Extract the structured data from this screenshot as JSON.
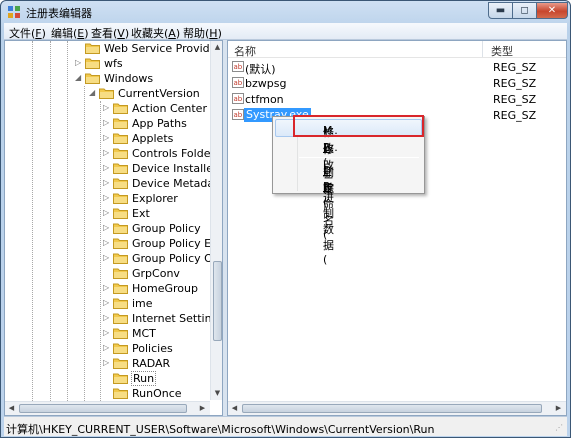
{
  "window": {
    "title": "注册表编辑器",
    "controls": {
      "minimize": "▬",
      "maximize": "◻",
      "close": "✕"
    }
  },
  "menu": [
    {
      "label": "文件(",
      "key": "F",
      "end": ")"
    },
    {
      "label": "编辑(",
      "key": "E",
      "end": ")"
    },
    {
      "label": "查看(",
      "key": "V",
      "end": ")"
    },
    {
      "label": "收藏夹(",
      "key": "A",
      "end": ")"
    },
    {
      "label": "帮助(",
      "key": "H",
      "end": ")"
    }
  ],
  "tree": [
    {
      "label": "Web Service Providers",
      "arrow": "",
      "selected": false
    },
    {
      "label": "wfs",
      "arrow": "▷",
      "selected": false
    },
    {
      "label": "Windows",
      "arrow": "◢",
      "selected": false
    },
    {
      "label": "CurrentVersion",
      "arrow": "◢",
      "selected": false
    },
    {
      "label": "Action Center",
      "arrow": "▷",
      "selected": false
    },
    {
      "label": "App Paths",
      "arrow": "▷",
      "selected": false
    },
    {
      "label": "Applets",
      "arrow": "▷",
      "selected": false
    },
    {
      "label": "Controls Folder",
      "arrow": "▷",
      "selected": false
    },
    {
      "label": "Device Installer",
      "arrow": "▷",
      "selected": false
    },
    {
      "label": "Device Metadata",
      "arrow": "▷",
      "selected": false
    },
    {
      "label": "Explorer",
      "arrow": "▷",
      "selected": false
    },
    {
      "label": "Ext",
      "arrow": "▷",
      "selected": false
    },
    {
      "label": "Group Policy",
      "arrow": "▷",
      "selected": false
    },
    {
      "label": "Group Policy Editor",
      "arrow": "▷",
      "selected": false
    },
    {
      "label": "Group Policy Objects",
      "arrow": "▷",
      "selected": false
    },
    {
      "label": "GrpConv",
      "arrow": "",
      "selected": false
    },
    {
      "label": "HomeGroup",
      "arrow": "▷",
      "selected": false
    },
    {
      "label": "ime",
      "arrow": "▷",
      "selected": false
    },
    {
      "label": "Internet Settings",
      "arrow": "▷",
      "selected": false
    },
    {
      "label": "MCT",
      "arrow": "▷",
      "selected": false
    },
    {
      "label": "Policies",
      "arrow": "▷",
      "selected": false
    },
    {
      "label": "RADAR",
      "arrow": "▷",
      "selected": false
    },
    {
      "label": "Run",
      "arrow": "",
      "selected": true
    },
    {
      "label": "RunOnce",
      "arrow": "",
      "selected": false
    }
  ],
  "values_pane": {
    "columns": {
      "name": "名称",
      "type": "类型"
    },
    "rows": [
      {
        "name": "(默认)",
        "type": "REG_SZ",
        "selected": false
      },
      {
        "name": "bzwpsg",
        "type": "REG_SZ",
        "selected": false
      },
      {
        "name": "ctfmon",
        "type": "REG_SZ",
        "selected": false
      },
      {
        "name": "Systray.exe",
        "type": "REG_SZ",
        "selected": true
      }
    ],
    "value_icon": "ab-string-icon"
  },
  "context_menu": [
    {
      "label": "修改(",
      "key": "M",
      "end": ")...",
      "highlighted": true
    },
    {
      "label": "修改二进制数据(",
      "key": "B",
      "end": ")...",
      "highlighted": false
    },
    {
      "label": "删除(",
      "key": "D",
      "end": ")",
      "highlighted": false
    },
    {
      "label": "重命名(",
      "key": "R",
      "end": ")",
      "highlighted": false
    }
  ],
  "status": {
    "path": "计算机\\HKEY_CURRENT_USER\\Software\\Microsoft\\Windows\\CurrentVersion\\Run"
  },
  "colors": {
    "accent_selection": "#3399ff",
    "annotation_box": "#d9262b",
    "folder": "#f2c94c"
  }
}
